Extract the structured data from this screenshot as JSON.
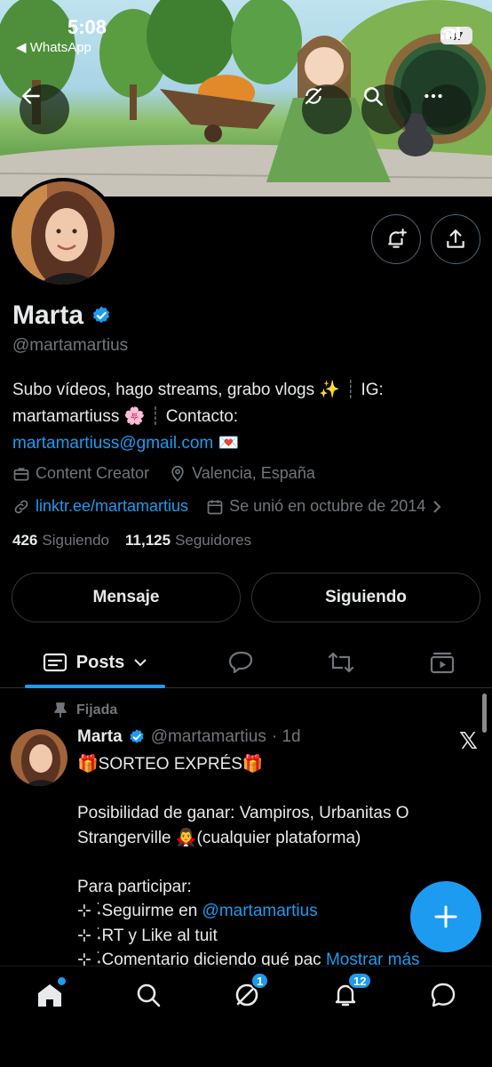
{
  "status_bar": {
    "time": "5:08",
    "back_app": "◀ WhatsApp",
    "battery": "47"
  },
  "header_actions": {
    "back_icon": "arrow-left-icon",
    "refresh_icon": "sync-off-icon",
    "search_icon": "search-icon",
    "more_icon": "more-horizontal-icon"
  },
  "profile": {
    "name": "Marta",
    "verified": true,
    "handle": "@martamartius",
    "bio_part1": "Subo vídeos, hago streams, grabo vlogs ✨",
    "bio_sep": "┊",
    "bio_part2": "IG: martamartiuss 🌸",
    "bio_part3": "Contacto:",
    "bio_email": "martamartiuss@gmail.com",
    "bio_emoji_end": "💌",
    "category": "Content Creator",
    "location": "Valencia, España",
    "website": "linktr.ee/martamartius",
    "joined": "Se unió en octubre de 2014",
    "following_count": "426",
    "following_label": "Siguiendo",
    "followers_count": "11,125",
    "followers_label": "Seguidores"
  },
  "buttons": {
    "message": "Mensaje",
    "following": "Siguiendo"
  },
  "tabs": {
    "posts_label": "Posts"
  },
  "post": {
    "pinned_label": "Fijada",
    "author_name": "Marta",
    "author_handle": "@martamartius",
    "time": "· 1d",
    "line1": "🎁SORTEO EXPRÉS🎁",
    "line2": "Posibilidad de ganar: Vampiros, Urbanitas O Strangerville 🧛‍♂️(cualquier plataforma)",
    "line3": "Para participar:",
    "line4_prefix": "⊹ ࣪˖Seguirme en ",
    "line4_mention": "@martamartius",
    "line5": "⊹ ࣪˖RT y Like al tuit",
    "line6": "⊹ ࣪˖Comentario diciendo qué pac",
    "show_more": "Mostrar más"
  },
  "bottom_nav": {
    "messages_badge": "1",
    "notifications_badge": "12"
  },
  "colors": {
    "accent": "#1d9bf0",
    "muted": "#71767b",
    "border": "#2f3336",
    "background": "#000000"
  }
}
